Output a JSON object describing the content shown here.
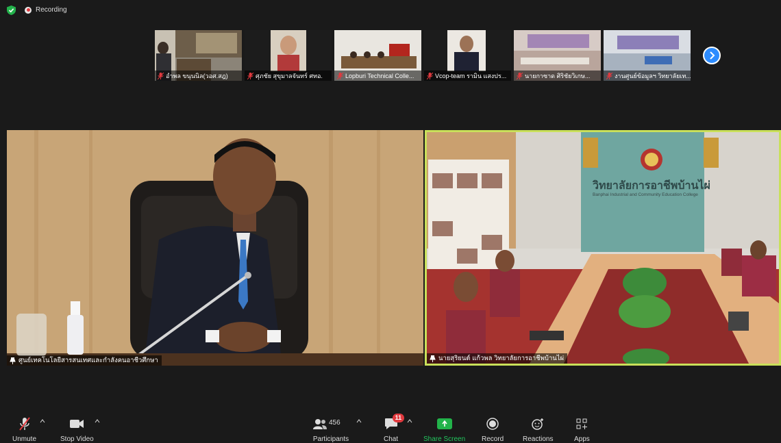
{
  "app": {
    "recording_label": "Recording"
  },
  "thumbnails": [
    {
      "name": "อำพล ขนุนนิล(วอศ.สฎ)"
    },
    {
      "name": "ศุภชัย สุขุมาลจันทร์ ศทอ."
    },
    {
      "name": "Lopburi Technical Colle..."
    },
    {
      "name": "Vcop-team รามิน แสงปร..."
    },
    {
      "name": "นายกาซาด ศิริชัยวิเกษ..."
    },
    {
      "name": "งานศูนย์ข้อมูลฯ วิทยาลัยเท..."
    }
  ],
  "main": {
    "left_name": "ศูนย์เทคโนโลยีสารสนเทศและกำลังคนอาชีวศึกษา",
    "right_name": "นายสุริยนต์ แก้วพล วิทยาลัยการอาชีพบ้านไผ่",
    "sign_th": "วิทยาลัยการอาชีพบ้านไผ่",
    "sign_en": "Banphai Industrial and Community Education College"
  },
  "toolbar": {
    "unmute": "Unmute",
    "stop_video": "Stop Video",
    "participants": "Participants",
    "participants_count": "456",
    "chat": "Chat",
    "chat_badge": "11",
    "share_screen": "Share Screen",
    "record": "Record",
    "reactions": "Reactions",
    "apps": "Apps"
  },
  "colors": {
    "accent": "#2d8cff",
    "active_speaker": "#c9e05a",
    "share": "#22b34a",
    "alert": "#e0393e"
  },
  "icons": [
    "shield-icon",
    "record-icon",
    "mic-muted-icon",
    "video-camera-icon",
    "participants-icon",
    "chat-icon",
    "share-screen-icon",
    "record-button-icon",
    "reactions-icon",
    "apps-icon",
    "chevron-right-icon",
    "pin-icon"
  ]
}
